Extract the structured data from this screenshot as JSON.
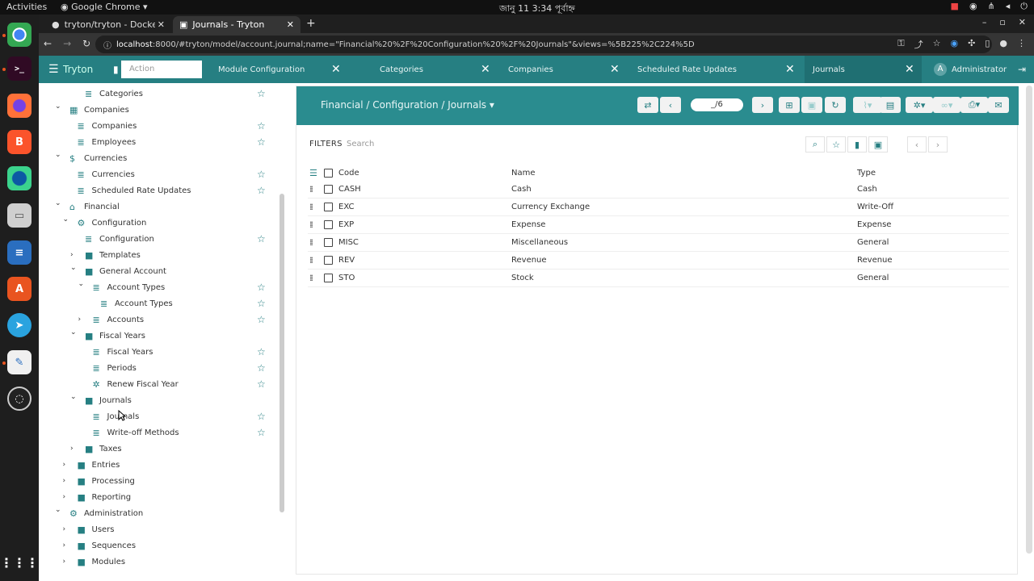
{
  "os": {
    "activities": "Activities",
    "app_name": "Google Chrome",
    "clock": "জানু 11  3:34 পূর্বাহ্ন"
  },
  "browser": {
    "tabs": [
      {
        "title": "tryton/tryton - Docker Im",
        "active": false
      },
      {
        "title": "Journals - Tryton",
        "active": true
      }
    ],
    "url_host": "localhost",
    "url_rest": ":8000/#tryton/model/account.journal;name=\"Financial%20%2F%20Configuration%20%2F%20Journals\"&views=%5B225%2C224%5D"
  },
  "app": {
    "brand": "Tryton",
    "action_placeholder": "Action",
    "tabs": [
      {
        "label": "Module Configuration",
        "active": false
      },
      {
        "label": "Categories",
        "active": false
      },
      {
        "label": "Companies",
        "active": false
      },
      {
        "label": "Scheduled Rate Updates",
        "active": false
      },
      {
        "label": "Journals",
        "active": true
      }
    ],
    "user_initial": "A",
    "user_name": "Administrator"
  },
  "sidebar": {
    "items": [
      {
        "label": "Categories",
        "depth": 3,
        "kind": "list",
        "chev": "",
        "fav": true
      },
      {
        "label": "Companies",
        "depth": 1,
        "kind": "company",
        "chev": "down",
        "fav": false
      },
      {
        "label": "Companies",
        "depth": 2,
        "kind": "list",
        "chev": "",
        "fav": true
      },
      {
        "label": "Employees",
        "depth": 2,
        "kind": "list",
        "chev": "",
        "fav": true
      },
      {
        "label": "Currencies",
        "depth": 1,
        "kind": "dollar",
        "chev": "down",
        "fav": false
      },
      {
        "label": "Currencies",
        "depth": 2,
        "kind": "list",
        "chev": "",
        "fav": true
      },
      {
        "label": "Scheduled Rate Updates",
        "depth": 2,
        "kind": "list",
        "chev": "",
        "fav": true
      },
      {
        "label": "Financial",
        "depth": 1,
        "kind": "bank",
        "chev": "down",
        "fav": false
      },
      {
        "label": "Configuration",
        "depth": 2,
        "kind": "gear",
        "chev": "down",
        "fav": false
      },
      {
        "label": "Configuration",
        "depth": 3,
        "kind": "list",
        "chev": "",
        "fav": true
      },
      {
        "label": "Templates",
        "depth": 3,
        "kind": "folder",
        "chev": "right",
        "fav": false
      },
      {
        "label": "General Account",
        "depth": 3,
        "kind": "folder",
        "chev": "down",
        "fav": false
      },
      {
        "label": "Account Types",
        "depth": 4,
        "kind": "tree",
        "chev": "down",
        "fav": true
      },
      {
        "label": "Account Types",
        "depth": 5,
        "kind": "list",
        "chev": "",
        "fav": true
      },
      {
        "label": "Accounts",
        "depth": 4,
        "kind": "tree",
        "chev": "right",
        "fav": true
      },
      {
        "label": "Fiscal Years",
        "depth": 3,
        "kind": "folder",
        "chev": "down",
        "fav": false
      },
      {
        "label": "Fiscal Years",
        "depth": 4,
        "kind": "list",
        "chev": "",
        "fav": true
      },
      {
        "label": "Periods",
        "depth": 4,
        "kind": "list",
        "chev": "",
        "fav": true
      },
      {
        "label": "Renew Fiscal Year",
        "depth": 4,
        "kind": "wizard",
        "chev": "",
        "fav": true
      },
      {
        "label": "Journals",
        "depth": 3,
        "kind": "folder",
        "chev": "down",
        "fav": false
      },
      {
        "label": "Journals",
        "depth": 4,
        "kind": "list",
        "chev": "",
        "fav": true
      },
      {
        "label": "Write-off Methods",
        "depth": 4,
        "kind": "list",
        "chev": "",
        "fav": true
      },
      {
        "label": "Taxes",
        "depth": 3,
        "kind": "folder",
        "chev": "right",
        "fav": false
      },
      {
        "label": "Entries",
        "depth": 2,
        "kind": "folder",
        "chev": "right",
        "fav": false
      },
      {
        "label": "Processing",
        "depth": 2,
        "kind": "folder",
        "chev": "right",
        "fav": false
      },
      {
        "label": "Reporting",
        "depth": 2,
        "kind": "folder",
        "chev": "right",
        "fav": false
      },
      {
        "label": "Administration",
        "depth": 1,
        "kind": "gear",
        "chev": "down",
        "fav": false
      },
      {
        "label": "Users",
        "depth": 2,
        "kind": "folder",
        "chev": "right",
        "fav": false
      },
      {
        "label": "Sequences",
        "depth": 2,
        "kind": "folder",
        "chev": "right",
        "fav": false
      },
      {
        "label": "Modules",
        "depth": 2,
        "kind": "folder",
        "chev": "right",
        "fav": false
      }
    ]
  },
  "form": {
    "title": "Financial / Configuration / Journals",
    "record_position": "_/6",
    "filters_label": "FILTERS",
    "search_placeholder": "Search",
    "columns": {
      "code": "Code",
      "name": "Name",
      "type": "Type"
    },
    "rows": [
      {
        "code": "CASH",
        "name": "Cash",
        "type": "Cash"
      },
      {
        "code": "EXC",
        "name": "Currency Exchange",
        "type": "Write-Off"
      },
      {
        "code": "EXP",
        "name": "Expense",
        "type": "Expense"
      },
      {
        "code": "MISC",
        "name": "Miscellaneous",
        "type": "General"
      },
      {
        "code": "REV",
        "name": "Revenue",
        "type": "Revenue"
      },
      {
        "code": "STO",
        "name": "Stock",
        "type": "General"
      }
    ]
  },
  "colors": {
    "header": "#267f82",
    "form_header": "#2a8c8f",
    "accent": "#267f82"
  }
}
